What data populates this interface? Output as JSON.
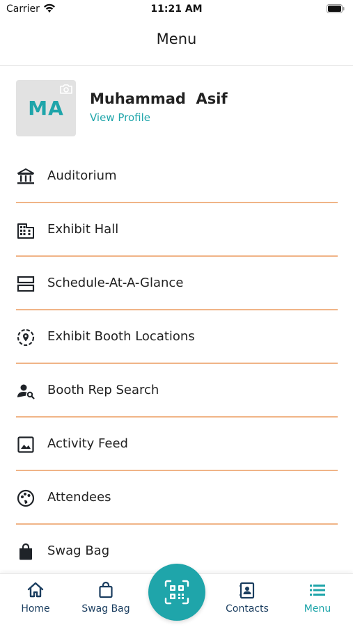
{
  "status_bar": {
    "carrier": "Carrier",
    "time": "11:21 AM"
  },
  "header": {
    "title": "Menu"
  },
  "profile": {
    "initials": "MA",
    "name": "Muhammad  Asif",
    "link": "View Profile"
  },
  "menu": {
    "items": [
      {
        "label": "Auditorium",
        "icon": "building-columns-icon"
      },
      {
        "label": "Exhibit Hall",
        "icon": "office-building-icon"
      },
      {
        "label": "Schedule-At-A-Glance",
        "icon": "stacked-rows-icon"
      },
      {
        "label": "Exhibit Booth Locations",
        "icon": "location-pin-icon"
      },
      {
        "label": "Booth Rep Search",
        "icon": "person-search-icon"
      },
      {
        "label": "Activity Feed",
        "icon": "image-icon"
      },
      {
        "label": "Attendees",
        "icon": "palette-icon"
      },
      {
        "label": "Swag Bag",
        "icon": "shopping-bag-icon"
      }
    ]
  },
  "tab_bar": {
    "home": "Home",
    "swag_bag": "Swag Bag",
    "contacts": "Contacts",
    "menu": "Menu"
  },
  "colors": {
    "accent": "#1fa5aa",
    "divider": "#f0b487",
    "nav_dark": "#1a3d5f"
  }
}
